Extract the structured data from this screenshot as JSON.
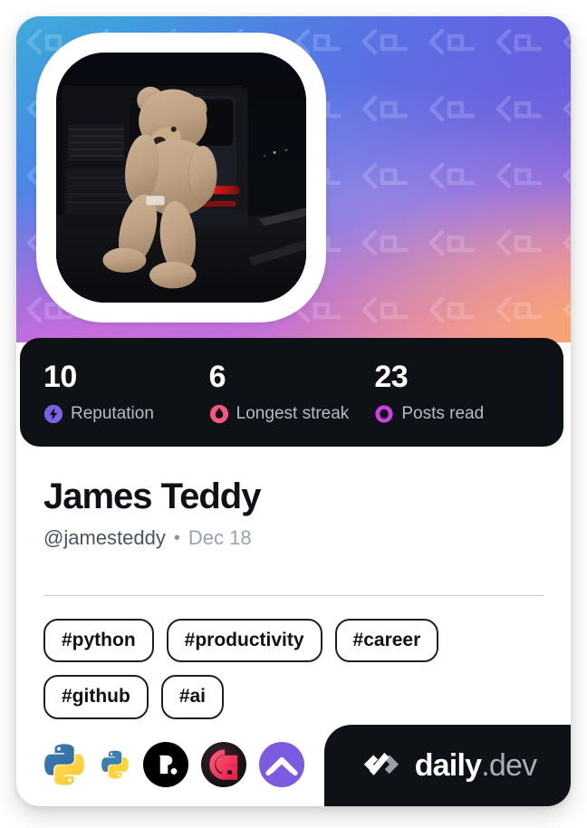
{
  "card": {
    "type": "devcard",
    "theme_bg": "#ffffff",
    "dark_panel_color": "#0e1217"
  },
  "cover": {
    "watermark_icon": "daily-dev-chevron-pattern",
    "gradient_colors": [
      "#46b9d6",
      "#4a86e8",
      "#6b6fe0",
      "#a76fd8",
      "#dd84c9",
      "#f0a58f"
    ]
  },
  "avatar": {
    "alt": "Large teddy bear leaning against a dark SUV at night"
  },
  "stats": [
    {
      "value": "10",
      "label": "Reputation",
      "icon": "reputation-badge-icon",
      "color": "#7b61e8"
    },
    {
      "value": "6",
      "label": "Longest streak",
      "icon": "streak-flame-icon",
      "color": "#f8557f"
    },
    {
      "value": "23",
      "label": "Posts read",
      "icon": "posts-read-ring-icon",
      "color": "#cf3ee0"
    }
  ],
  "profile": {
    "display_name": "James Teddy",
    "handle": "@jamesteddy",
    "separator": "•",
    "joined": "Dec 18"
  },
  "tags": [
    {
      "label": "#python"
    },
    {
      "label": "#productivity"
    },
    {
      "label": "#career"
    },
    {
      "label": "#github"
    },
    {
      "label": "#ai"
    }
  ],
  "sources": [
    {
      "name": "python-logo-icon"
    },
    {
      "name": "python-small-logo-icon"
    },
    {
      "name": "real-python-icon"
    },
    {
      "name": "g-logo-icon"
    },
    {
      "name": "purple-chevron-icon"
    }
  ],
  "brand": {
    "mark": "daily-dev-logo-icon",
    "name": "daily",
    "suffix": ".dev"
  }
}
